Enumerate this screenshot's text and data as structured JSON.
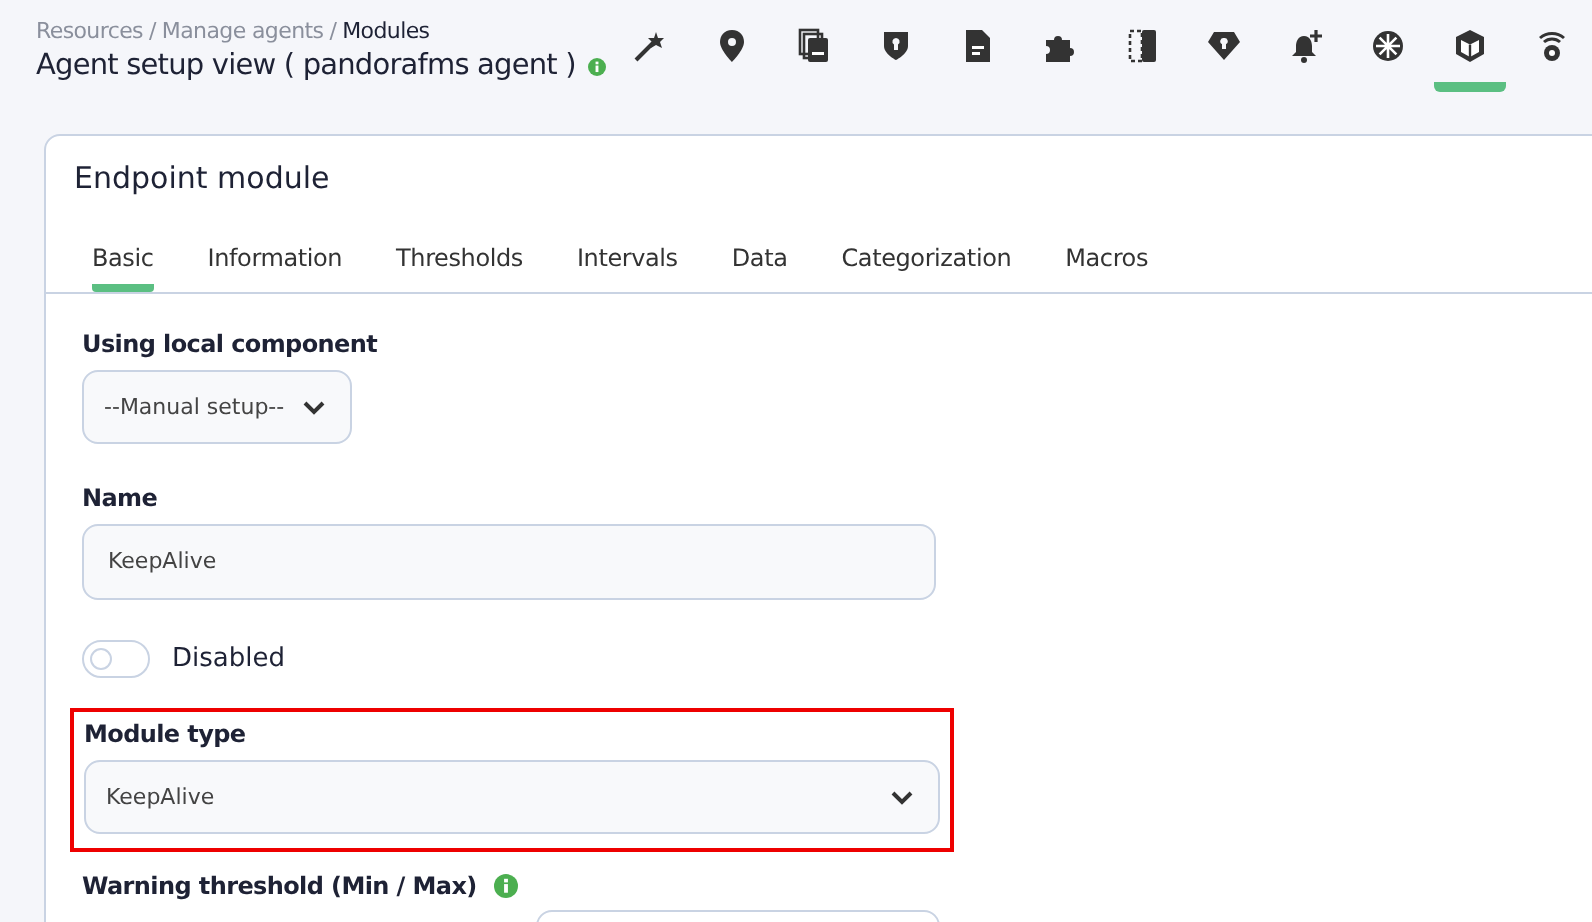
{
  "breadcrumb": [
    {
      "label": "Resources",
      "current": false
    },
    {
      "label": "Manage agents",
      "current": false
    },
    {
      "label": "Modules",
      "current": true
    }
  ],
  "breadcrumb_separator": "/",
  "page_title": "Agent setup view ( pandorafms agent )",
  "toolbar": [
    {
      "selected": false
    },
    {
      "selected": false
    },
    {
      "selected": false
    },
    {
      "selected": false
    },
    {
      "selected": false
    },
    {
      "selected": false
    },
    {
      "selected": false
    },
    {
      "selected": false
    },
    {
      "selected": false
    },
    {
      "selected": false
    },
    {
      "selected": true
    },
    {
      "selected": false
    }
  ],
  "card": {
    "title": "Endpoint module",
    "tabs": [
      {
        "label": "Basic",
        "selected": true
      },
      {
        "label": "Information",
        "selected": false
      },
      {
        "label": "Thresholds",
        "selected": false
      },
      {
        "label": "Intervals",
        "selected": false
      },
      {
        "label": "Data",
        "selected": false
      },
      {
        "label": "Categorization",
        "selected": false
      },
      {
        "label": "Macros",
        "selected": false
      }
    ],
    "local_component": {
      "label": "Using local component",
      "value": "--Manual setup--"
    },
    "name": {
      "label": "Name",
      "value": "KeepAlive"
    },
    "disabled_toggle": {
      "label": "Disabled",
      "on": false
    },
    "module_type": {
      "label": "Module type",
      "value": "KeepAlive",
      "highlighted": true
    },
    "warning_threshold": {
      "label": "Warning threshold (Min / Max)"
    }
  }
}
